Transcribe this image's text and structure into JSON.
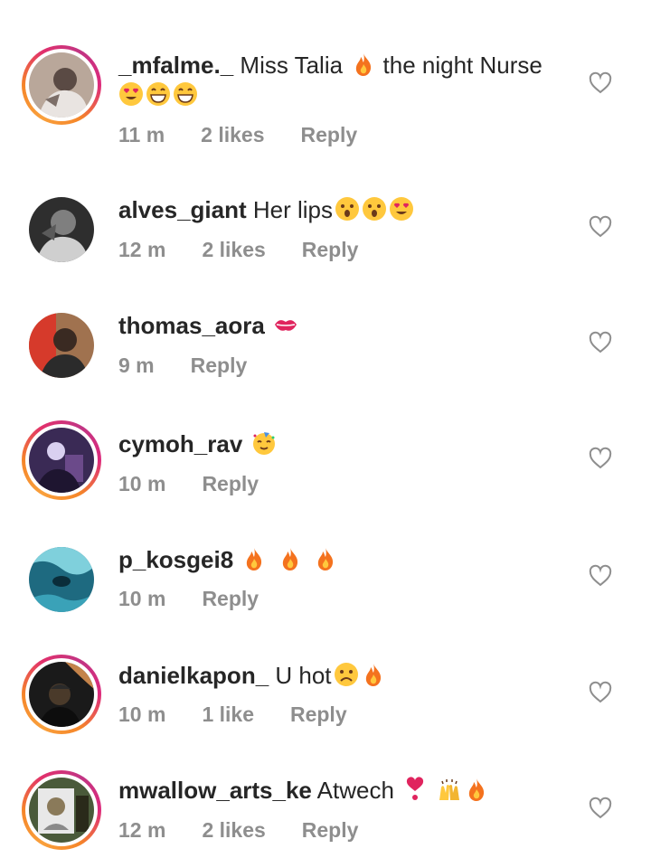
{
  "comments": [
    {
      "username": "_mfalme._",
      "text": " Miss Talia",
      "text2": "  the night Nurse",
      "emoji_line": "😍😁😁",
      "time": "11 m",
      "likes": "2 likes",
      "reply": "Reply",
      "story": true,
      "avatar_colors": [
        "#b9a79a",
        "#e9e4e1",
        "#7c6e68"
      ]
    },
    {
      "username": "alves_giant",
      "text": " Her lips",
      "time": "12 m",
      "likes": "2 likes",
      "reply": "Reply",
      "story": false,
      "avatar_colors": [
        "#3a3a3a",
        "#cfcfcf",
        "#7f7f7f"
      ]
    },
    {
      "username": "thomas_aora",
      "text": " ",
      "time": "9 m",
      "likes": "",
      "reply": "Reply",
      "story": false,
      "avatar_colors": [
        "#d63a2b",
        "#2b2b2b",
        "#a0724f"
      ]
    },
    {
      "username": "cymoh_rav",
      "text": " ",
      "time": "10 m",
      "likes": "",
      "reply": "Reply",
      "story": true,
      "avatar_colors": [
        "#3a2a55",
        "#d9d0f0",
        "#6b4a8a"
      ]
    },
    {
      "username": "p_kosgei8",
      "text": " ",
      "time": "10 m",
      "likes": "",
      "reply": "Reply",
      "story": false,
      "avatar_colors": [
        "#1e6a80",
        "#7fd0dc",
        "#0a2d3a"
      ]
    },
    {
      "username": "danielkapon_",
      "text": " U hot",
      "time": "10 m",
      "likes": "1 like",
      "reply": "Reply",
      "story": true,
      "avatar_colors": [
        "#1a1a1a",
        "#c4834a",
        "#4a3a2a"
      ]
    },
    {
      "username": "mwallow_arts_ke",
      "text": " Atwech ",
      "time": "12 m",
      "likes": "2 likes",
      "reply": "Reply",
      "story": true,
      "avatar_colors": [
        "#4a5a3a",
        "#e8e8e8",
        "#8a7a5a"
      ]
    }
  ]
}
